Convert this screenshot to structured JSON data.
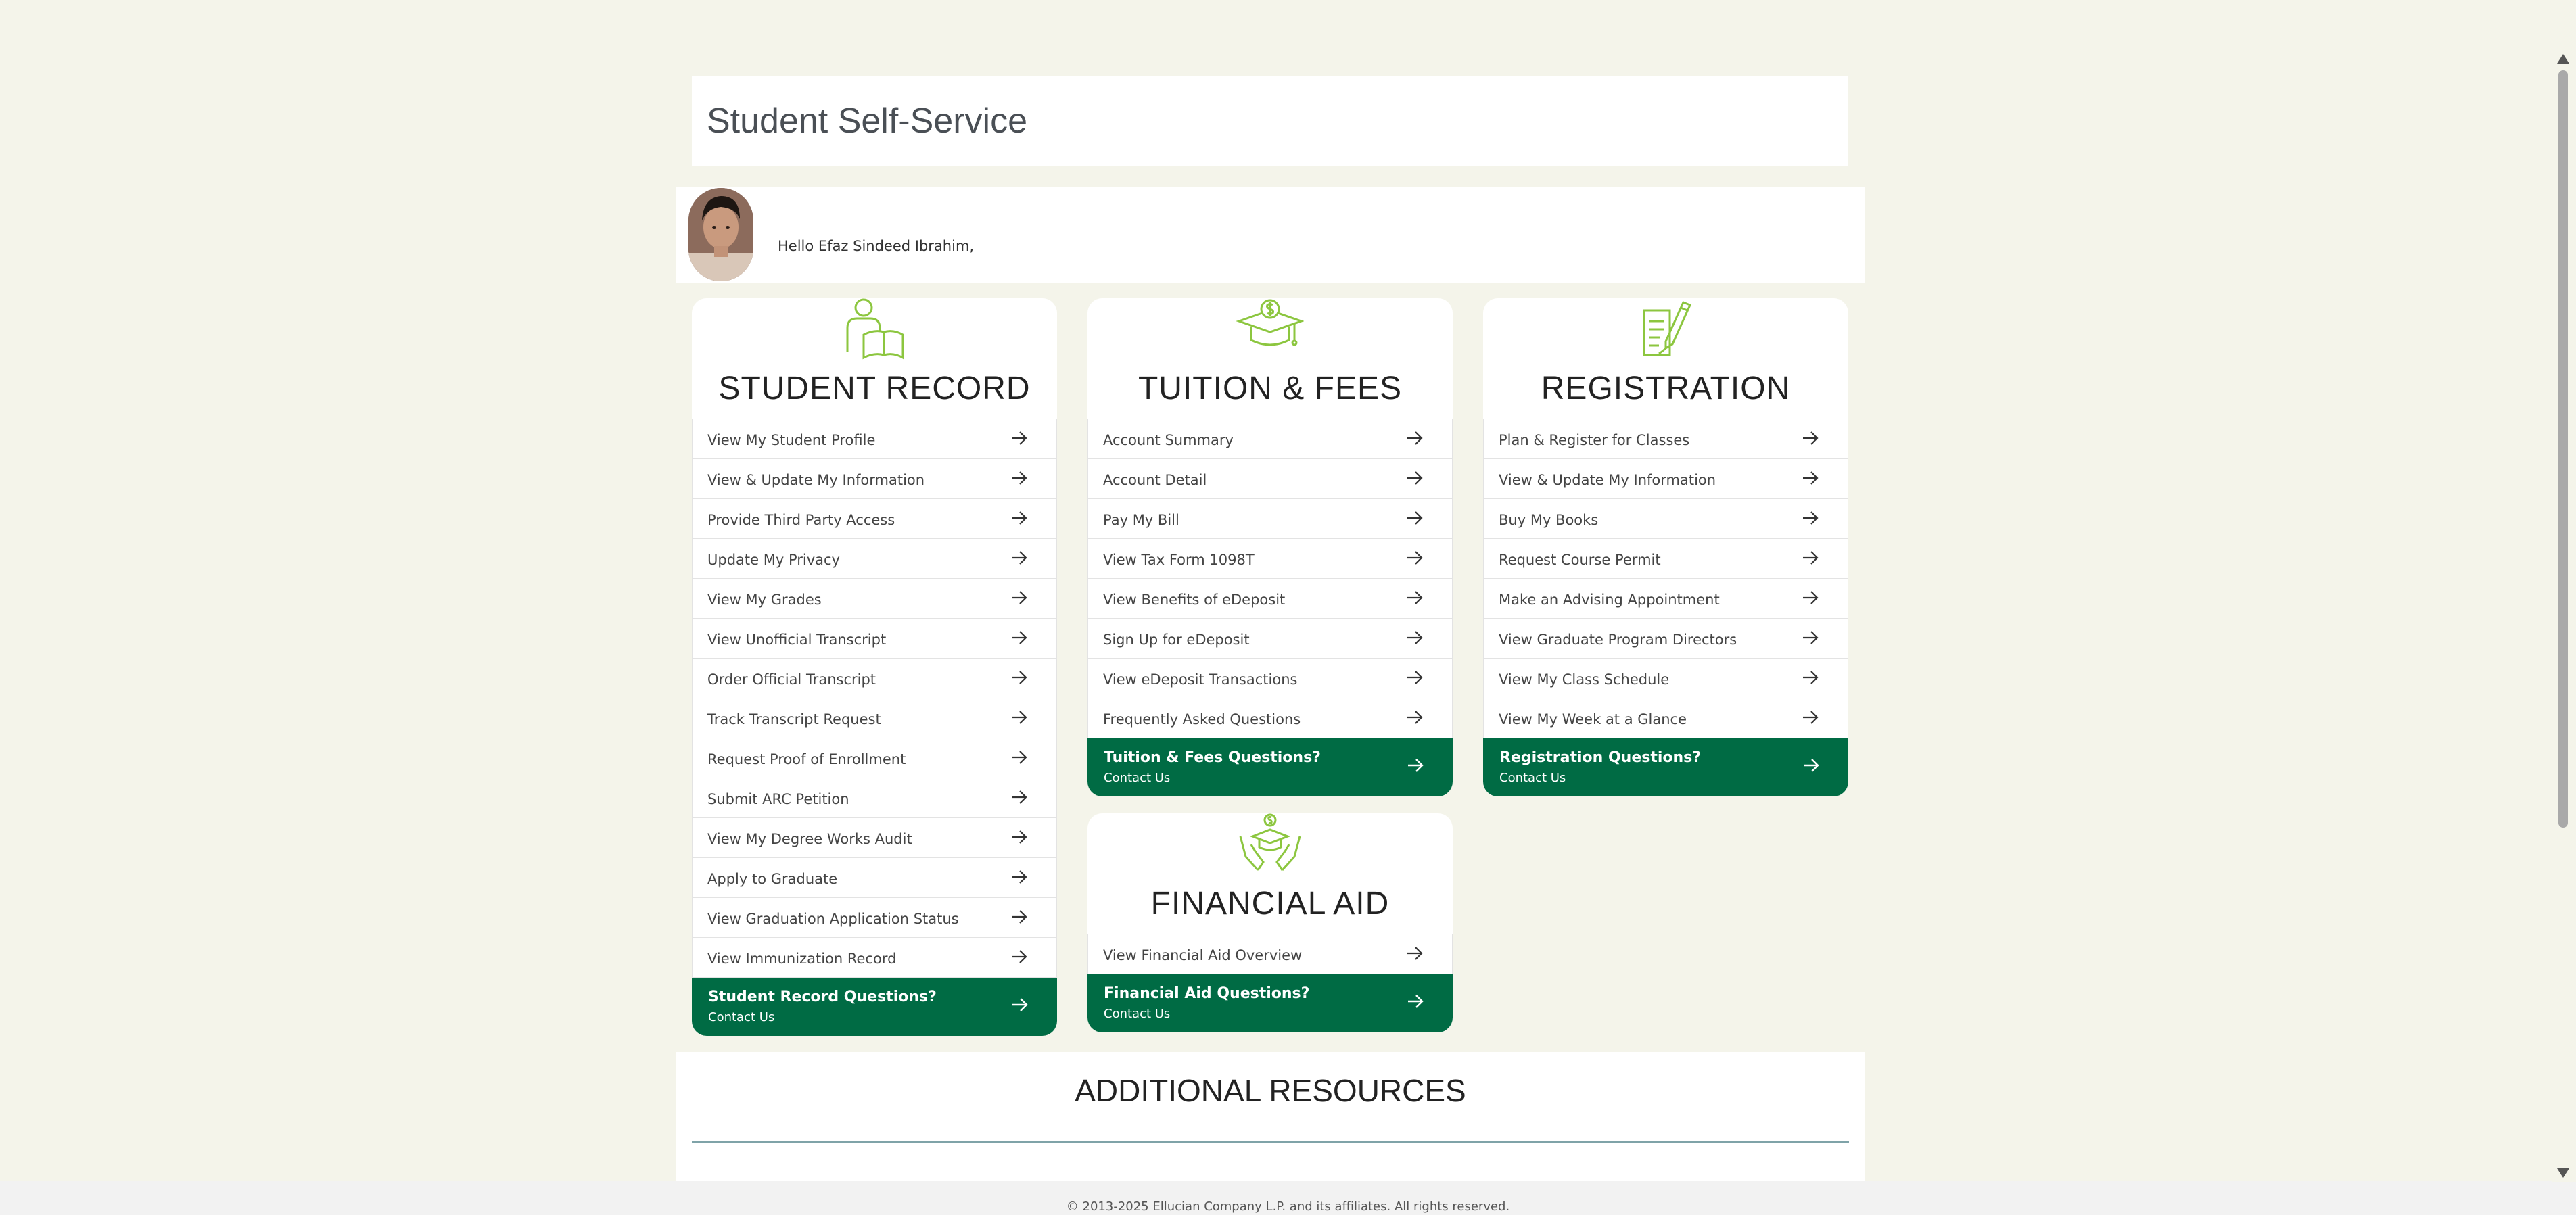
{
  "page": {
    "title": "Student Self-Service",
    "greeting": "Hello Efaz Sindeed Ibrahim,"
  },
  "colors": {
    "background": "#f4f4ea",
    "accent_green": "#006b44",
    "icon_green": "#8cc63f"
  },
  "cards": {
    "student_record": {
      "icon": "student-reading-book-icon",
      "title": "STUDENT RECORD",
      "items": [
        "View My Student Profile",
        "View & Update My Information",
        "Provide Third Party Access",
        "Update My Privacy",
        "View My Grades",
        "View Unofficial Transcript",
        "Order Official Transcript",
        "Track Transcript Request",
        "Request Proof of Enrollment",
        "Submit ARC Petition",
        "View My Degree Works Audit",
        "Apply to Graduate",
        "View Graduation Application Status",
        "View Immunization Record"
      ],
      "contact_title": "Student Record Questions?",
      "contact_sub": "Contact Us"
    },
    "tuition_fees": {
      "icon": "graduation-cap-dollar-icon",
      "title": "TUITION & FEES",
      "items": [
        "Account Summary",
        "Account Detail",
        "Pay My Bill",
        "View Tax Form 1098T",
        "View Benefits of eDeposit",
        "Sign Up for eDeposit",
        "View eDeposit Transactions",
        "Frequently Asked Questions"
      ],
      "contact_title": "Tuition & Fees Questions?",
      "contact_sub": "Contact Us"
    },
    "registration": {
      "icon": "document-pencil-icon",
      "title": "REGISTRATION",
      "items": [
        "Plan & Register for Classes",
        "View & Update My Information",
        "Buy My Books",
        "Request Course Permit",
        "Make an Advising Appointment",
        "View Graduate Program Directors",
        "View My Class Schedule",
        "View My Week at a Glance"
      ],
      "contact_title": "Registration Questions?",
      "contact_sub": "Contact Us"
    },
    "financial_aid": {
      "icon": "hands-holding-cap-icon",
      "title": "FINANCIAL AID",
      "items": [
        "View Financial Aid Overview"
      ],
      "contact_title": "Financial Aid Questions?",
      "contact_sub": "Contact Us"
    }
  },
  "resources": {
    "title": "ADDITIONAL RESOURCES"
  },
  "footer": {
    "text": "© 2013-2025 Ellucian Company L.P. and its affiliates. All rights reserved."
  }
}
